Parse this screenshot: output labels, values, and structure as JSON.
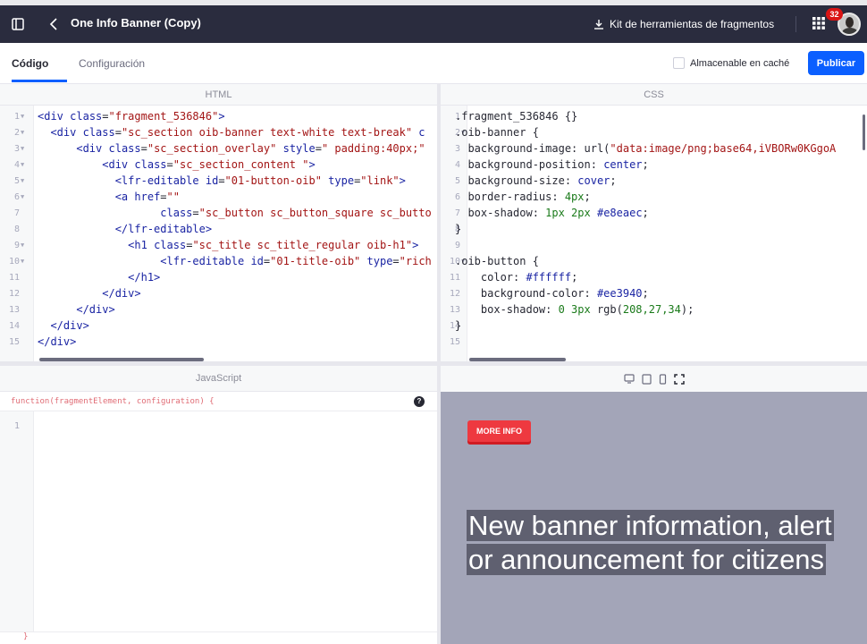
{
  "topbar": {
    "title": "One Info Banner (Copy)",
    "kit_label": "Kit de herramientas de fragmentos",
    "notifications": "32"
  },
  "tabs": [
    {
      "label": "Código"
    },
    {
      "label": "Configuración"
    }
  ],
  "cache_label": "Almacenable en caché",
  "publish_label": "Publicar",
  "panels": {
    "html": "HTML",
    "css": "CSS",
    "js": "JavaScript"
  },
  "html_lines": [
    "1",
    "2",
    "3",
    "4",
    "5",
    "6",
    "7",
    "8",
    "9",
    "10",
    "11",
    "12",
    "13",
    "14",
    "15"
  ],
  "css_lines": [
    "1",
    "2",
    "3",
    "4",
    "5",
    "6",
    "7",
    "8",
    "9",
    "10",
    "11",
    "12",
    "13",
    "14",
    "15"
  ],
  "js": {
    "signature": "function(fragmentElement, configuration) {",
    "line1": "1",
    "closing": "}"
  },
  "preview": {
    "button": "MORE INFO",
    "headline": "New banner information, alert or announcement for citizens"
  },
  "colors": {
    "topbar": "#2a2c3e",
    "primary": "#0b5fff",
    "banner_button": "#ee3940",
    "preview_bg": "#a3a5b8"
  }
}
